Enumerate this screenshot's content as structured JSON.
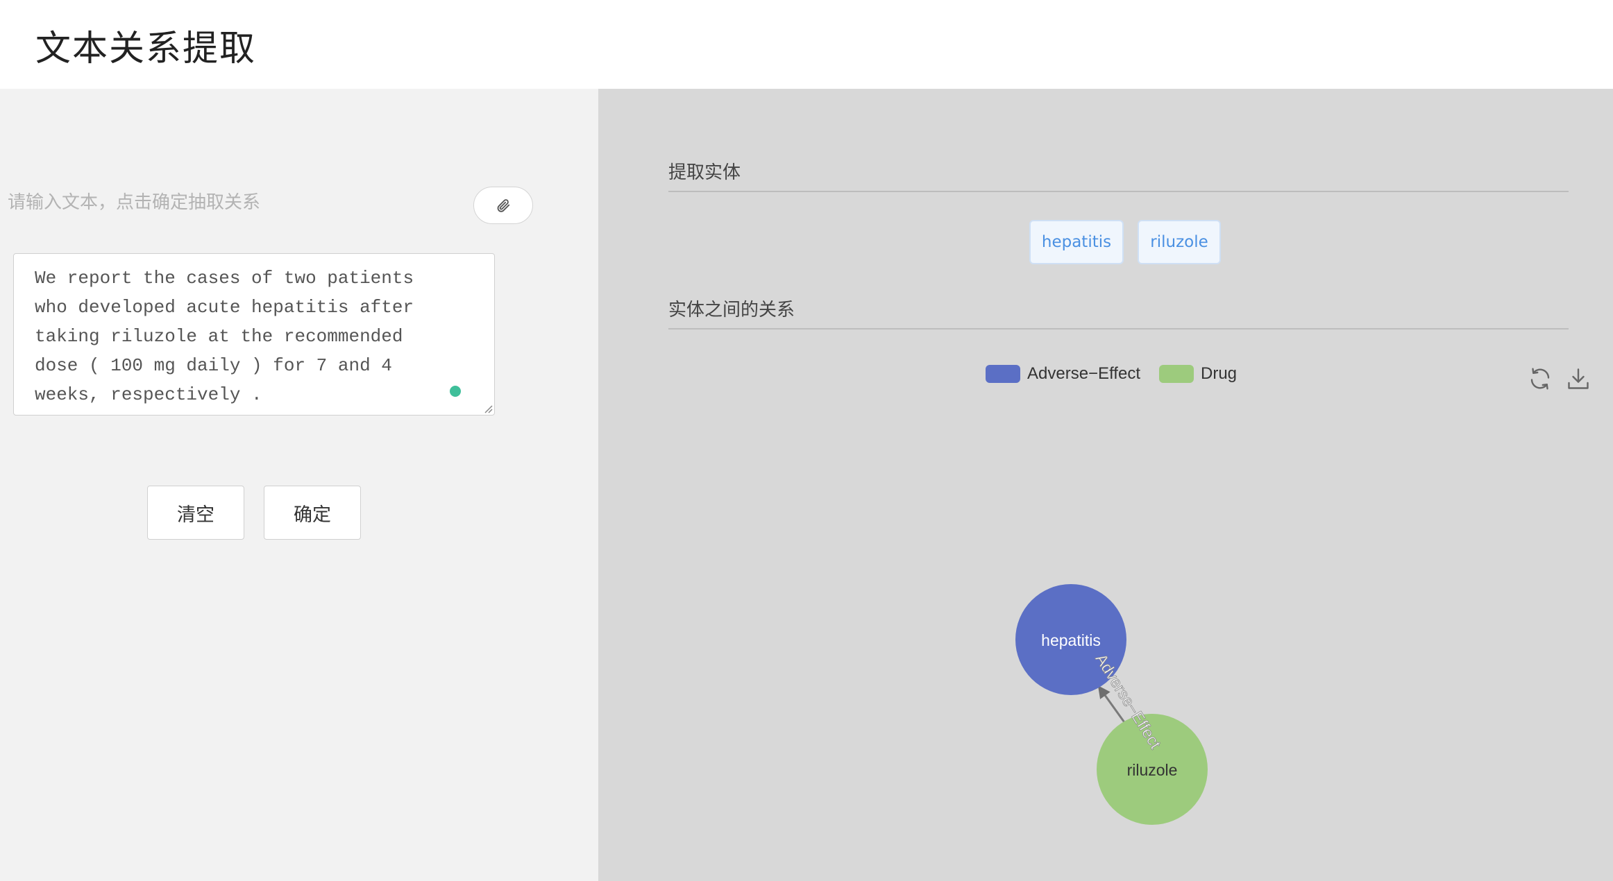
{
  "header": {
    "title": "文本关系提取"
  },
  "input_panel": {
    "prompt": "请输入文本，点击确定抽取关系",
    "attach_icon": "paperclip-icon",
    "text": "We report the cases of two patients\nwho developed acute hepatitis after\ntaking riluzole at the recommended\ndose ( 100 mg daily ) for 7 and 4\nweeks, respectively .",
    "clear_label": "清空",
    "confirm_label": "确定",
    "status_color": "#3fbf9a"
  },
  "results": {
    "entities_title": "提取实体",
    "entities": [
      "hepatitis",
      "riluzole"
    ],
    "relations_title": "实体之间的关系",
    "legend": [
      {
        "label": "Adverse−Effect",
        "color": "#5b6fc5"
      },
      {
        "label": "Drug",
        "color": "#9dcb7d"
      }
    ],
    "tools": {
      "refresh_icon": "refresh-icon",
      "download_icon": "download-icon"
    },
    "graph": {
      "nodes": [
        {
          "label": "hepatitis",
          "category": "Adverse−Effect",
          "color": "#5b6fc5"
        },
        {
          "label": "riluzole",
          "category": "Drug",
          "color": "#9dcb7d"
        }
      ],
      "edges": [
        {
          "source": "riluzole",
          "target": "hepatitis",
          "label": "Adverse−Effect"
        }
      ]
    }
  }
}
